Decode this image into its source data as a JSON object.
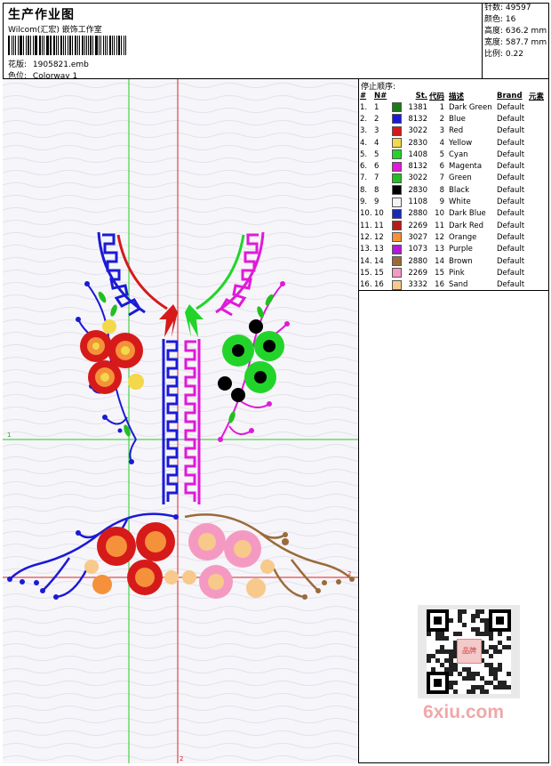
{
  "header": {
    "title": "生产作业图",
    "subtitle": "Wilcom(汇宏) 嵌饰工作室",
    "pattern_label": "花版:",
    "pattern_value": "1905821.emb",
    "colorway_label": "色位:",
    "colorway_value": "Colorway 1"
  },
  "stats": [
    {
      "label": "针数",
      "value": "49597"
    },
    {
      "label": "颜色",
      "value": "16"
    },
    {
      "label": "高度",
      "value": "636.2 mm"
    },
    {
      "label": "宽度",
      "value": "587.7 mm"
    },
    {
      "label": "比例",
      "value": "0.22"
    }
  ],
  "stop_sequence": {
    "title": "停止顺序:",
    "columns": [
      "#",
      "N#",
      "St.",
      "代码",
      "描述",
      "Brand",
      "元素"
    ],
    "rows": [
      {
        "idx": "1.",
        "n": "1",
        "color": "#1a7a1a",
        "st": "1381",
        "code": "1",
        "desc": "Dark Green",
        "brand": "Default"
      },
      {
        "idx": "2.",
        "n": "2",
        "color": "#1a1ad6",
        "st": "8132",
        "code": "2",
        "desc": "Blue",
        "brand": "Default"
      },
      {
        "idx": "3.",
        "n": "3",
        "color": "#d61a1a",
        "st": "3022",
        "code": "3",
        "desc": "Red",
        "brand": "Default"
      },
      {
        "idx": "4.",
        "n": "4",
        "color": "#f2d84a",
        "st": "2830",
        "code": "4",
        "desc": "Yellow",
        "brand": "Default"
      },
      {
        "idx": "5.",
        "n": "5",
        "color": "#22d42a",
        "st": "1408",
        "code": "5",
        "desc": "Cyan",
        "brand": "Default"
      },
      {
        "idx": "6.",
        "n": "6",
        "color": "#e01ad8",
        "st": "8132",
        "code": "6",
        "desc": "Magenta",
        "brand": "Default"
      },
      {
        "idx": "7.",
        "n": "7",
        "color": "#20c020",
        "st": "3022",
        "code": "7",
        "desc": "Green",
        "brand": "Default"
      },
      {
        "idx": "8.",
        "n": "8",
        "color": "#000000",
        "st": "2830",
        "code": "8",
        "desc": "Black",
        "brand": "Default"
      },
      {
        "idx": "9.",
        "n": "9",
        "color": "#f4f4f4",
        "st": "1108",
        "code": "9",
        "desc": "White",
        "brand": "Default"
      },
      {
        "idx": "10.",
        "n": "10",
        "color": "#1a2ab8",
        "st": "2880",
        "code": "10",
        "desc": "Dark Blue",
        "brand": "Default"
      },
      {
        "idx": "11.",
        "n": "11",
        "color": "#b81a1a",
        "st": "2269",
        "code": "11",
        "desc": "Dark Red",
        "brand": "Default"
      },
      {
        "idx": "12.",
        "n": "12",
        "color": "#f5913a",
        "st": "3027",
        "code": "12",
        "desc": "Orange",
        "brand": "Default"
      },
      {
        "idx": "13.",
        "n": "13",
        "color": "#b21ad6",
        "st": "1073",
        "code": "13",
        "desc": "Purple",
        "brand": "Default"
      },
      {
        "idx": "14.",
        "n": "14",
        "color": "#9a6a3a",
        "st": "2880",
        "code": "14",
        "desc": "Brown",
        "brand": "Default"
      },
      {
        "idx": "15.",
        "n": "15",
        "color": "#f49ac2",
        "st": "2269",
        "code": "15",
        "desc": "Pink",
        "brand": "Default"
      },
      {
        "idx": "16.",
        "n": "16",
        "color": "#f7c98a",
        "st": "3332",
        "code": "16",
        "desc": "Sand",
        "brand": "Default"
      }
    ]
  },
  "guides": {
    "v_label": "1",
    "h_label": "1",
    "h2_label": "2",
    "v2_label": "2"
  },
  "watermark": {
    "logo_text": "6xiu.com",
    "seal_text": "品牌"
  }
}
